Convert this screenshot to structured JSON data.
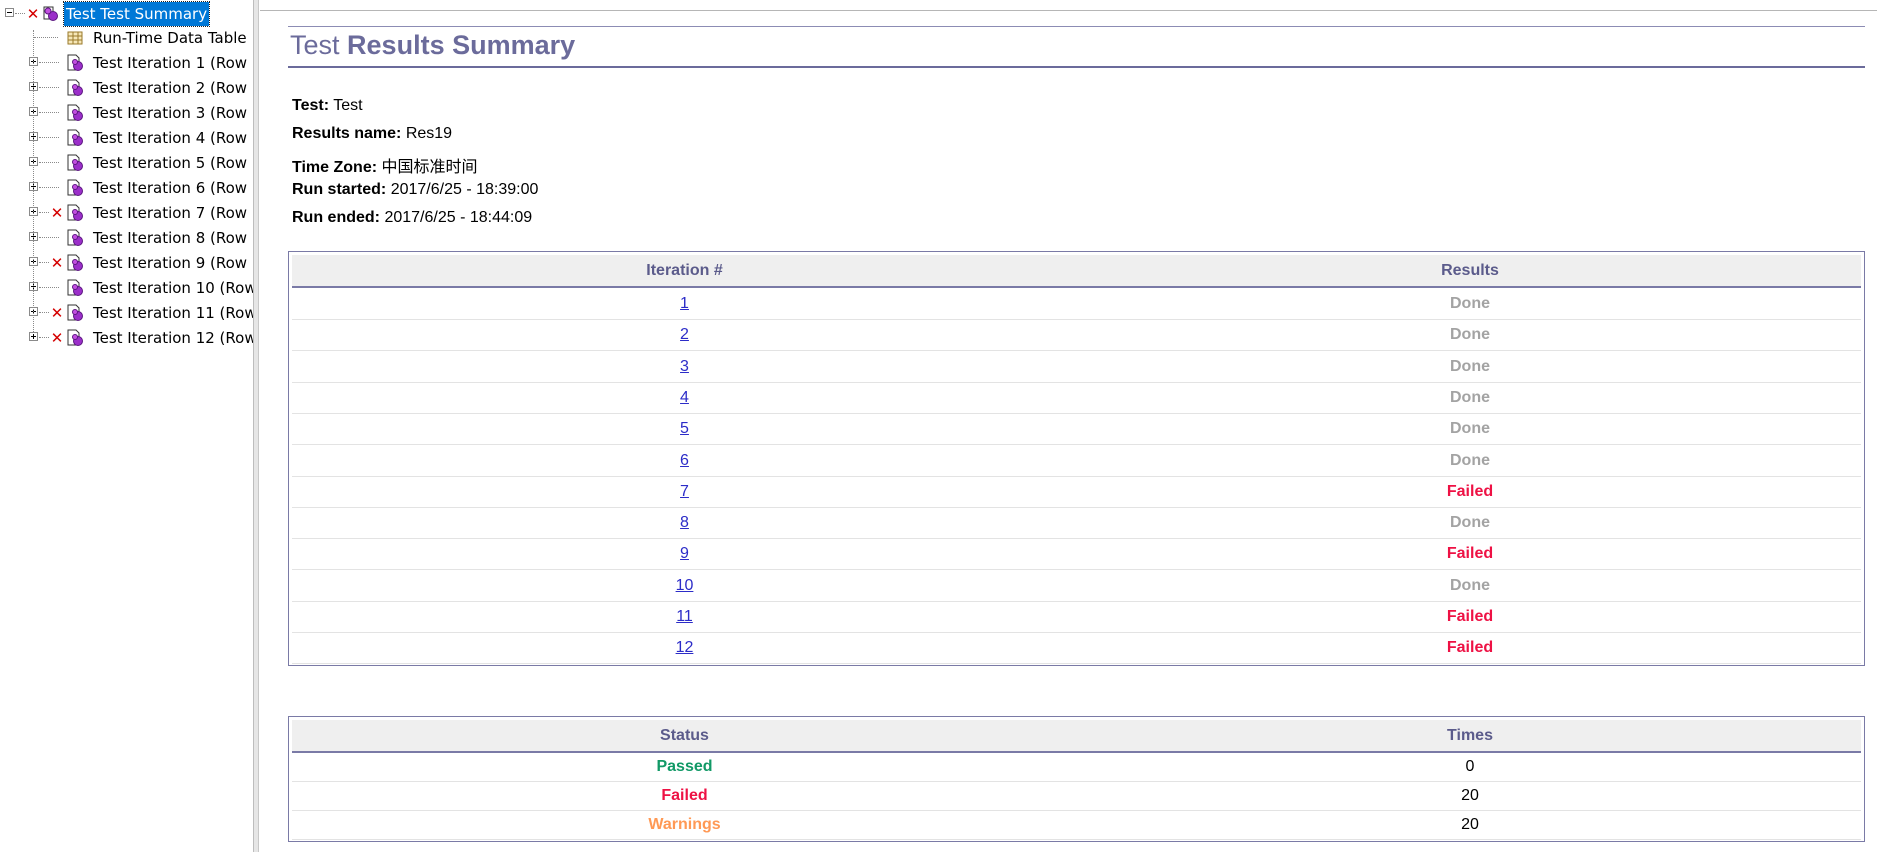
{
  "tree": {
    "root": {
      "label": "Test Test Summary",
      "status": "failed"
    },
    "datatable": {
      "label": "Run-Time Data Table"
    },
    "iterations": [
      {
        "label": "Test Iteration 1 (Row",
        "failed": false
      },
      {
        "label": "Test Iteration 2 (Row",
        "failed": false
      },
      {
        "label": "Test Iteration 3 (Row",
        "failed": false
      },
      {
        "label": "Test Iteration 4 (Row",
        "failed": false
      },
      {
        "label": "Test Iteration 5 (Row",
        "failed": false
      },
      {
        "label": "Test Iteration 6 (Row",
        "failed": false
      },
      {
        "label": "Test Iteration 7 (Row",
        "failed": true
      },
      {
        "label": "Test Iteration 8 (Row",
        "failed": false
      },
      {
        "label": "Test Iteration 9 (Row",
        "failed": true
      },
      {
        "label": "Test Iteration 10 (Row",
        "failed": false
      },
      {
        "label": "Test Iteration 11 (Row",
        "failed": true
      },
      {
        "label": "Test Iteration 12 (Row",
        "failed": true
      }
    ]
  },
  "report": {
    "title_part1": "Test",
    "title_part2": "Results Summary",
    "info": {
      "test_label": "Test",
      "test_value": "Test",
      "results_name_label": "Results name",
      "results_name_value": "Res19",
      "time_zone_label": "Time Zone",
      "time_zone_value": "中国标准时间",
      "run_started_label": "Run started",
      "run_started_value": "2017/6/25 - 18:39:00",
      "run_ended_label": "Run ended",
      "run_ended_value": "2017/6/25 - 18:44:09"
    },
    "iterations_table": {
      "headers": [
        "Iteration #",
        "Results"
      ],
      "rows": [
        {
          "iteration": "1",
          "result": "Done"
        },
        {
          "iteration": "2",
          "result": "Done"
        },
        {
          "iteration": "3",
          "result": "Done"
        },
        {
          "iteration": "4",
          "result": "Done"
        },
        {
          "iteration": "5",
          "result": "Done"
        },
        {
          "iteration": "6",
          "result": "Done"
        },
        {
          "iteration": "7",
          "result": "Failed"
        },
        {
          "iteration": "8",
          "result": "Done"
        },
        {
          "iteration": "9",
          "result": "Failed"
        },
        {
          "iteration": "10",
          "result": "Done"
        },
        {
          "iteration": "11",
          "result": "Failed"
        },
        {
          "iteration": "12",
          "result": "Failed"
        }
      ]
    },
    "status_table": {
      "headers": [
        "Status",
        "Times"
      ],
      "rows": [
        {
          "status": "Passed",
          "times": "0"
        },
        {
          "status": "Failed",
          "times": "20"
        },
        {
          "status": "Warnings",
          "times": "20"
        }
      ]
    }
  },
  "colors": {
    "title": "#6b6b9b",
    "link": "#2c2cc8",
    "done": "#a3a3a3",
    "failed": "#ee1144",
    "passed": "#119966",
    "warnings": "#ff9955",
    "selection": "#0078d7"
  }
}
